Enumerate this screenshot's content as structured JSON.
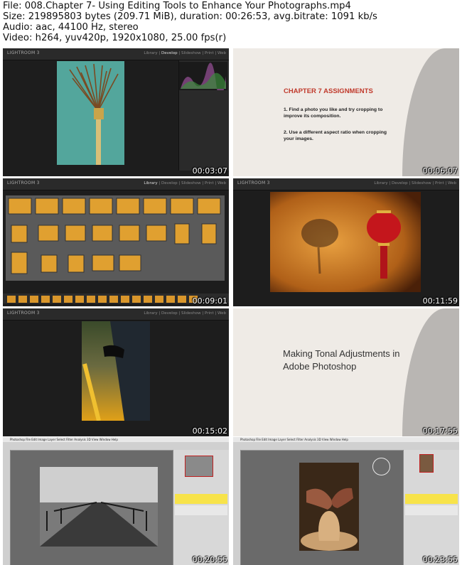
{
  "header": {
    "line1": "File: 008.Chapter 7- Using Editing Tools to Enhance Your Photographs.mp4",
    "line2": "Size: 219895803 bytes (209.71 MiB), duration: 00:26:53, avg.bitrate: 1091 kb/s",
    "line3": "Audio: aac, 44100 Hz, stereo",
    "line4": "Video: h264, yuv420p, 1920x1080, 25.00 fps(r)"
  },
  "lightroom": {
    "logo": "LIGHTROOM 3",
    "module_library": "Library",
    "module_develop": "Develop",
    "module_slideshow": "Slideshow",
    "module_print": "Print",
    "module_web": "Web",
    "sep": "|"
  },
  "slides": {
    "assign_title": "CHAPTER 7 ASSIGNMENTS",
    "assign_item1": "1.  Find a photo you like and try cropping to improve its composition.",
    "assign_item2": "2.  Use a different aspect ratio when cropping your images.",
    "tonal_title": "Making Tonal Adjustments in Adobe Photoshop"
  },
  "photoshop": {
    "menubar": "Photoshop  File  Edit  Image  Layer  Select  Filter  Analysis  3D  View  Window  Help"
  },
  "timestamps": [
    "00:03:07",
    "00:06:07",
    "00:09:01",
    "00:11:59",
    "00:15:02",
    "00:17:55",
    "00:20:55",
    "00:23:55"
  ]
}
